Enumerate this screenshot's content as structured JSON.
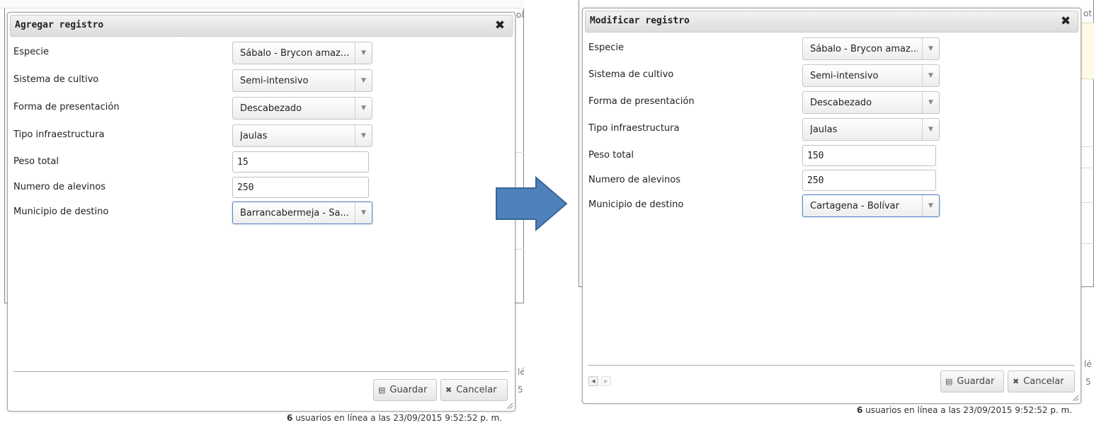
{
  "arrow_color": "#4f81bd",
  "left_dialog": {
    "title": "Agregar registro",
    "close_icon": "close-icon",
    "fields": [
      {
        "label": "Especie",
        "type": "select",
        "value": "Sábalo - Brycon amaz..."
      },
      {
        "label": "Sistema de cultivo",
        "type": "select",
        "value": "Semi-intensivo"
      },
      {
        "label": "Forma de presentación",
        "type": "select",
        "value": "Descabezado"
      },
      {
        "label": "Tipo infraestructura",
        "type": "select",
        "value": "Jaulas"
      },
      {
        "label": "Peso total",
        "type": "text",
        "value": "15"
      },
      {
        "label": "Numero de alevinos",
        "type": "text",
        "value": "250"
      },
      {
        "label": "Municipio de destino",
        "type": "select",
        "value": "Barrancabermeja - Sa...",
        "focused": true
      }
    ],
    "save_label": "Guardar",
    "cancel_label": "Cancelar"
  },
  "right_dialog": {
    "title": "Modificar registro",
    "close_icon": "close-icon",
    "fields": [
      {
        "label": "Especie",
        "type": "select",
        "value": "Sábalo - Brycon amaz..."
      },
      {
        "label": "Sistema de cultivo",
        "type": "select",
        "value": "Semi-intensivo"
      },
      {
        "label": "Forma de presentación",
        "type": "select",
        "value": "Descabezado"
      },
      {
        "label": "Tipo infraestructura",
        "type": "select",
        "value": "Jaulas"
      },
      {
        "label": "Peso total",
        "type": "text",
        "value": "150"
      },
      {
        "label": "Numero de alevinos",
        "type": "text",
        "value": "250"
      },
      {
        "label": "Municipio de destino",
        "type": "select",
        "value": "Cartagena - Bolívar",
        "focused": true
      }
    ],
    "save_label": "Guardar",
    "cancel_label": "Cancelar"
  },
  "status": {
    "users_count": "6",
    "users_text": "usuarios en línea a las 23/09/2015 9:52:52 p. m."
  },
  "background_snippets": {
    "left_top": "ol",
    "left_mid1": "lé",
    "left_mid2": "5",
    "right_top": "ot",
    "right_mid1": "lé",
    "right_mid2": "5"
  }
}
